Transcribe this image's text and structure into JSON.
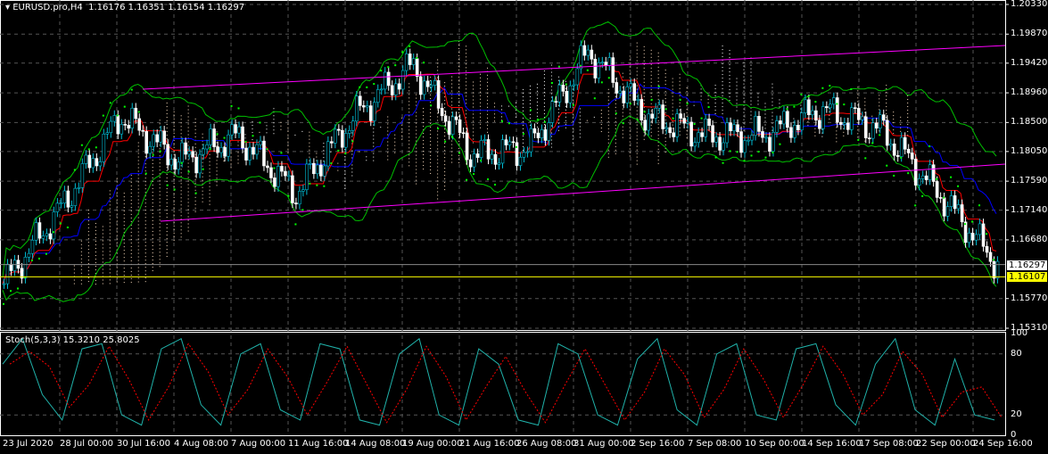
{
  "header": {
    "symbol": "EURUSD.pro,H4",
    "open": "1.16176",
    "high": "1.16351",
    "low": "1.16154",
    "close": "1.16297"
  },
  "indicator": {
    "name": "Stoch(5,3,3)",
    "main": "15.3210",
    "signal": "25.8025"
  },
  "colors": {
    "bull": "#00bcd4",
    "bear": "#ffffff",
    "bands": "#00c000",
    "trend": "#ff00ff",
    "sar": "#00ff00",
    "kijun": "#0000ff",
    "tenkan": "#ff0000",
    "stoch_main": "#20b2aa",
    "stoch_signal": "#ff0000",
    "ask": "#ffff00"
  },
  "chart_data": {
    "type": "line",
    "title": "EURUSD.pro,H4",
    "ylim": [
      1.1531,
      1.2033
    ],
    "price_ticks": [
      "1.20330",
      "1.19870",
      "1.19420",
      "1.18960",
      "1.18500",
      "1.18050",
      "1.17590",
      "1.17140",
      "1.16680",
      "1.15770",
      "1.15310"
    ],
    "price_values": [
      1.2033,
      1.1987,
      1.1942,
      1.1896,
      1.185,
      1.1805,
      1.1759,
      1.1714,
      1.1668,
      1.1577,
      1.1531
    ],
    "bid_label": "1.16297",
    "bid": 1.16297,
    "ask_label": "1.16107",
    "ask": 1.16107,
    "x_labels": [
      "23 Jul 2020",
      "28 Jul 00:00",
      "30 Jul 16:00",
      "4 Aug 08:00",
      "7 Aug 00:00",
      "11 Aug 16:00",
      "14 Aug 08:00",
      "19 Aug 00:00",
      "21 Aug 16:00",
      "26 Aug 08:00",
      "31 Aug 00:00",
      "2 Sep 16:00",
      "7 Sep 08:00",
      "10 Sep 00:00",
      "14 Sep 16:00",
      "17 Sep 08:00",
      "22 Sep 00:00",
      "24 Sep 16:00"
    ],
    "approx_close_at_labels": [
      1.16,
      1.172,
      1.186,
      1.179,
      1.183,
      1.174,
      1.186,
      1.194,
      1.18,
      1.181,
      1.196,
      1.186,
      1.183,
      1.183,
      1.187,
      1.184,
      1.174,
      1.163
    ],
    "stoch_ticks": [
      "100",
      "80",
      "20",
      "0"
    ],
    "stoch_ylim": [
      0,
      100
    ],
    "stoch_main": [
      70,
      95,
      40,
      15,
      85,
      90,
      20,
      10,
      85,
      95,
      30,
      10,
      80,
      90,
      25,
      15,
      90,
      85,
      15,
      10,
      80,
      95,
      20,
      10,
      85,
      70,
      15,
      10,
      90,
      80,
      20,
      10,
      75,
      95,
      25,
      10,
      80,
      90,
      20,
      15,
      85,
      90,
      30,
      10,
      70,
      95,
      25,
      10,
      75,
      20,
      15
    ]
  }
}
